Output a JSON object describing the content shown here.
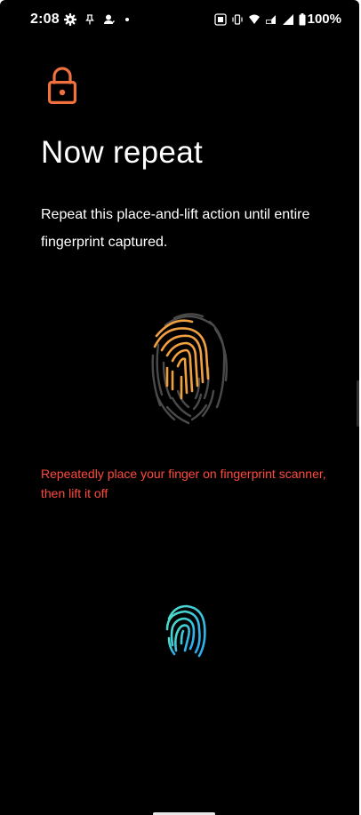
{
  "status_bar": {
    "time": "2:08",
    "left_icons": [
      "gear-icon",
      "pin-icon",
      "assistant-icon",
      "dot-icon"
    ],
    "right_icons": [
      "nfc-icon",
      "vibrate-icon",
      "wifi-icon",
      "lte-icon",
      "signal-icon",
      "battery-icon"
    ],
    "battery": "100%"
  },
  "header": {
    "icon": "lock-icon",
    "title": "Now repeat",
    "description": "Repeat this place-and-lift action until entire fingerprint captured."
  },
  "enrollment": {
    "progress_icon": "fingerprint-progress-icon",
    "instruction": "Repeatedly place your finger on fingerprint scanner, then lift it off",
    "sensor_icon": "fingerprint-sensor-icon"
  },
  "colors": {
    "background": "#000000",
    "accent_orange": "#f07040",
    "progress_orange": "#f0a040",
    "instruction_red": "#ff4a3d",
    "sensor_cyan": "#3ecfe8"
  }
}
